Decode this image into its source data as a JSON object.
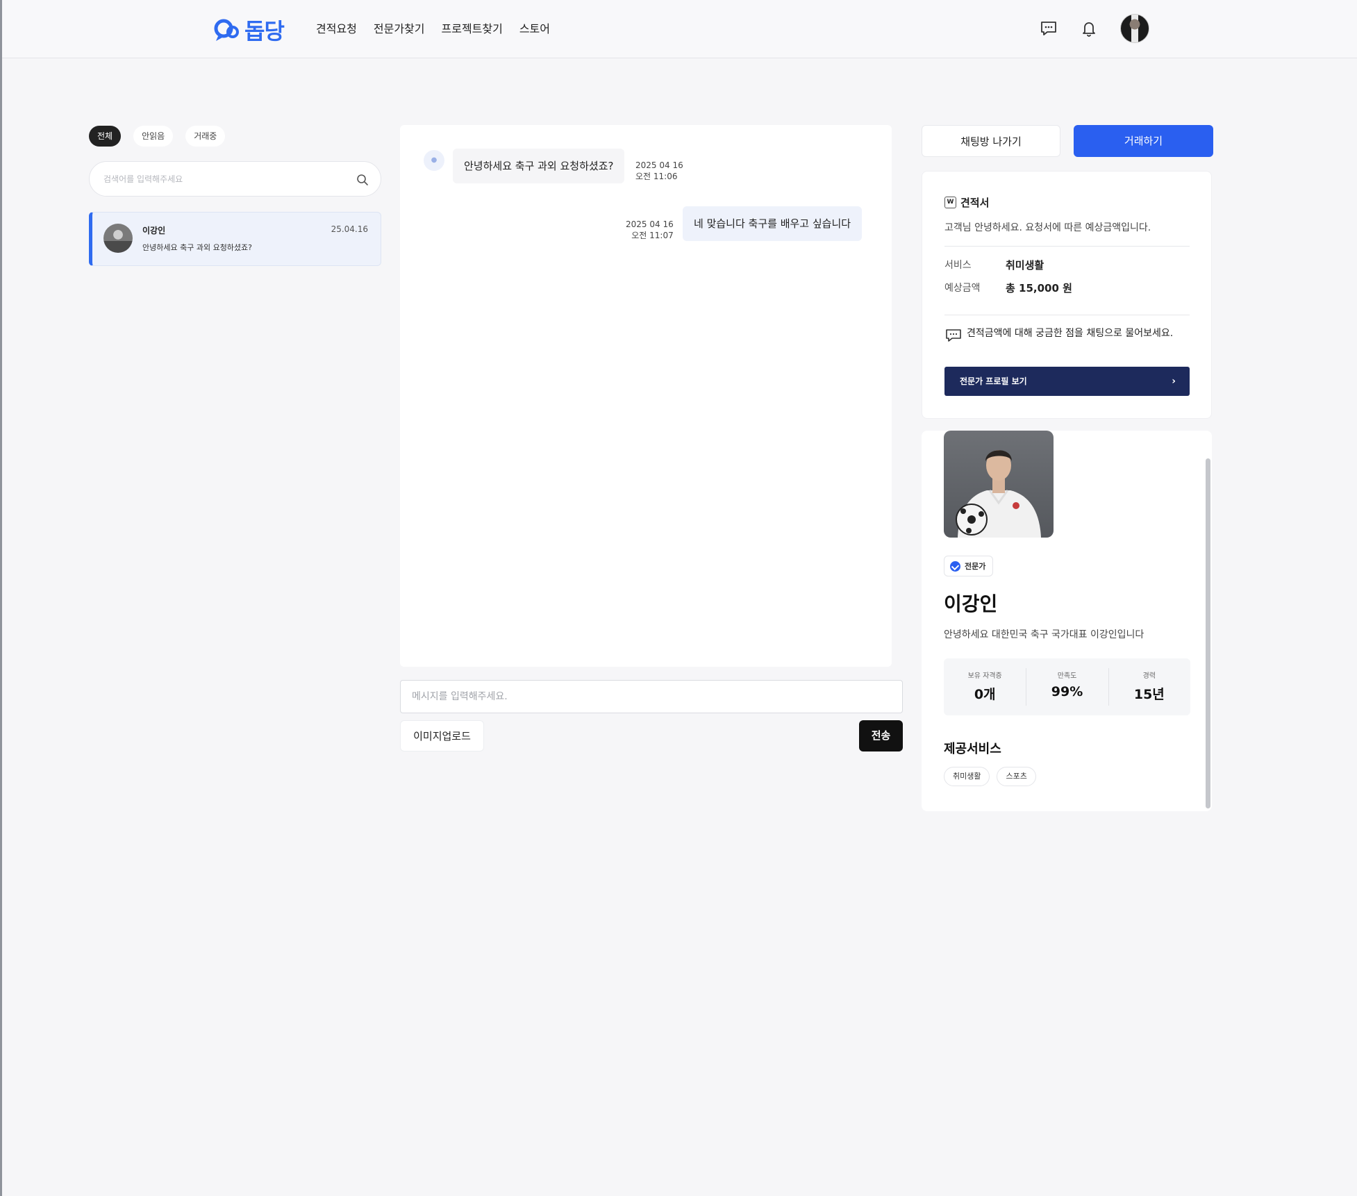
{
  "header": {
    "logo_text": "돕당",
    "nav": [
      "견적요청",
      "전문가찾기",
      "프로젝트찾기",
      "스토어"
    ]
  },
  "filters": [
    "전체",
    "안읽음",
    "거래중"
  ],
  "search": {
    "placeholder": "검색어를 입력해주세요"
  },
  "chat_list": [
    {
      "name": "이강인",
      "preview": "안녕하세요 축구 과외 요청하셨죠?",
      "date": "25.04.16"
    }
  ],
  "messages": [
    {
      "direction": "in",
      "text": "안녕하세요 축구 과외 요청하셨죠?",
      "date": "2025 04 16",
      "time": "오전 11:06"
    },
    {
      "direction": "out",
      "text": "네 맞습니다 축구를 배우고 싶습니다",
      "date": "2025 04 16",
      "time": "오전 11:07"
    }
  ],
  "composer": {
    "placeholder": "메시지를 입력해주세요.",
    "upload_label": "이미지업로드",
    "send_label": "전송"
  },
  "actions": {
    "leave_label": "채팅방 나가기",
    "deal_label": "거래하기"
  },
  "quote": {
    "badge": "W",
    "title": "견적서",
    "greeting": "고객님 안녕하세요. 요청서에 따른 예상금액입니다.",
    "service_label": "서비스",
    "service_value": "취미생활",
    "price_label": "예상금액",
    "price_value": "총 15,000 원",
    "note": "견적금액에 대해 궁금한 점을 채팅으로 물어보세요.",
    "profile_button": "전문가 프로필 보기"
  },
  "expert": {
    "badge": "전문가",
    "name": "이강인",
    "intro": "안녕하세요 대한민국 축구 국가대표 이강인입니다",
    "stats": [
      {
        "label": "보유 자격증",
        "value": "0개"
      },
      {
        "label": "만족도",
        "value": "99%"
      },
      {
        "label": "경력",
        "value": "15년"
      }
    ],
    "services_title": "제공서비스",
    "services": [
      "취미생활",
      "스포츠"
    ]
  },
  "colors": {
    "accent": "#2a5ff0",
    "navy": "#1d2a5c",
    "logo": "#2f6bf0"
  }
}
